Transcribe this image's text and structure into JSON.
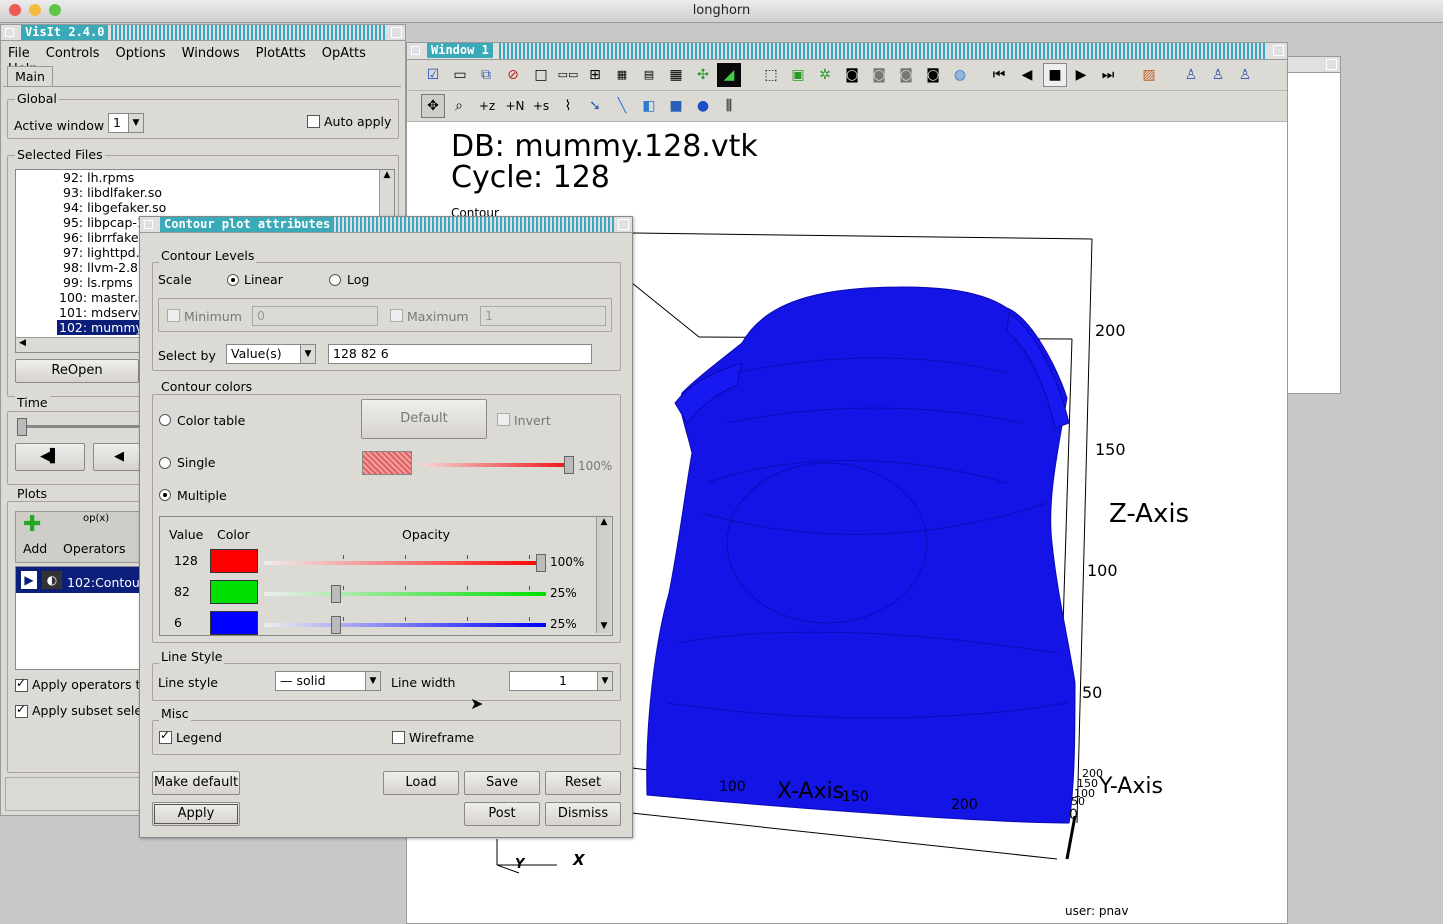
{
  "mac": {
    "title": "longhorn"
  },
  "main_window": {
    "title": "VisIt 2.4.0",
    "menu": [
      "File",
      "Controls",
      "Options",
      "Windows",
      "PlotAtts",
      "OpAtts",
      "Help"
    ],
    "tab": "Main",
    "global": {
      "label": "Global",
      "active_window_label": "Active window",
      "active_window_value": "1",
      "auto_apply": "Auto apply"
    },
    "files": {
      "label": "Selected Files",
      "items": [
        "92: lh.rpms",
        "93: libdlfaker.so",
        "94: libgefaker.so",
        "95: libpcap-1",
        "96: librrfaker",
        "97: lighttpd.c",
        "98: llvm-2.8.t",
        "99: ls.rpms",
        "100: master.s",
        "101: mdserve",
        "102: mummy.1"
      ],
      "selected": "102: mummy.1",
      "reopen": "ReOpen"
    },
    "time": {
      "label": "Time"
    },
    "plots": {
      "label": "Plots",
      "add": "Add",
      "operators": "Operators",
      "plot_item": "102:Contour",
      "apply_operators": "Apply operators t",
      "apply_subset": "Apply subset sele"
    }
  },
  "viz_window": {
    "title": "Window 1",
    "db_label": "DB: mummy.128.vtk",
    "cycle_label": "Cycle: 128",
    "plot_label": "Contour",
    "z_axis": "Z-Axis",
    "x_axis": "X-Axis",
    "y_axis": "Y-Axis",
    "z_ticks": [
      "200",
      "150",
      "100",
      "50"
    ],
    "x_ticks": [
      "100",
      "150",
      "200"
    ],
    "y_ticks": [
      "200",
      "150",
      "100",
      "50",
      "0"
    ],
    "triad_x": "X",
    "triad_y": "Y",
    "user_text": "user: pnav"
  },
  "dialog": {
    "title": "Contour plot attributes",
    "levels": {
      "label": "Contour Levels",
      "scale_label": "Scale",
      "linear": "Linear",
      "log": "Log",
      "minimum": "Minimum",
      "min_value": "0",
      "maximum": "Maximum",
      "max_value": "1",
      "select_by_label": "Select by",
      "select_by_value": "Value(s)",
      "values_text": "128 82 6"
    },
    "colors": {
      "label": "Contour colors",
      "color_table": "Color table",
      "default_btn": "Default",
      "invert": "Invert",
      "single": "Single",
      "single_opacity": "100%",
      "multiple": "Multiple",
      "col_value": "Value",
      "col_color": "Color",
      "col_opacity": "Opacity",
      "rows": [
        {
          "value": "128",
          "color": "#ff0000",
          "opacity_label": "100%",
          "opacity": 1.0
        },
        {
          "value": "82",
          "color": "#00e000",
          "opacity_label": "25%",
          "opacity": 0.25
        },
        {
          "value": "6",
          "color": "#0000ff",
          "opacity_label": "25%",
          "opacity": 0.25
        }
      ]
    },
    "line": {
      "label": "Line Style",
      "style_label": "Line style",
      "style_value": "— solid",
      "width_label": "Line width",
      "width_value": "1"
    },
    "misc": {
      "label": "Misc",
      "legend": "Legend",
      "wireframe": "Wireframe"
    },
    "buttons": {
      "make_default": "Make default",
      "load": "Load",
      "save": "Save",
      "reset": "Reset",
      "apply": "Apply",
      "post": "Post",
      "dismiss": "Dismiss"
    }
  },
  "colors": {
    "titlebar": "#3aa9b8",
    "selection": "#0a1e7a",
    "mesh": "#1010e0"
  }
}
